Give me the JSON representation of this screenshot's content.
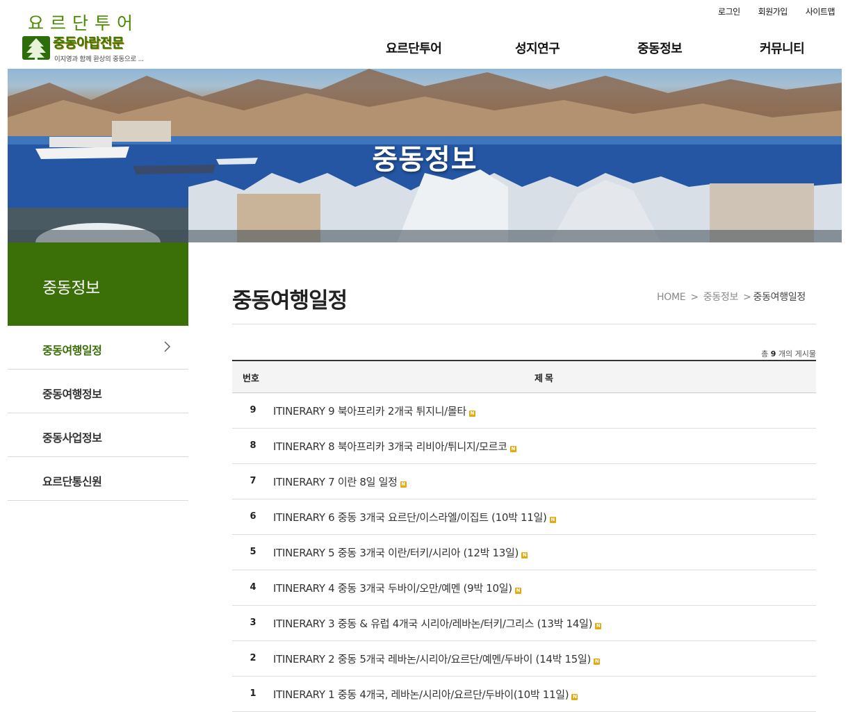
{
  "logo": {
    "top_text": "요르단투어",
    "brand": "중동아랍전문",
    "tagline": "이지영과 함께 환상의 중동으로 ..."
  },
  "util_links": [
    "로그인",
    "회원가입",
    "사이트맵"
  ],
  "gnb": [
    "요르단투어",
    "성지연구",
    "중동정보",
    "커뮤니티"
  ],
  "banner": {
    "title": "중동정보"
  },
  "lnb": {
    "title": "중동정보",
    "items": [
      "중동여행일정",
      "중동여행정보",
      "중동사업정보",
      "요르단통신원"
    ],
    "active_index": 0
  },
  "page": {
    "title": "중동여행일정",
    "breadcrumb": [
      "HOME",
      "중동정보",
      "중동여행일정"
    ],
    "breadcrumb_sep": ">"
  },
  "board": {
    "total_prefix": "총",
    "total_count": "9",
    "total_suffix": "개의 게시물",
    "header_num": "번호",
    "header_title": "제목",
    "new_badge": "N",
    "rows": [
      {
        "num": "9",
        "title": "ITINERARY 9 북아프리카 2개국 튀지니/몰타"
      },
      {
        "num": "8",
        "title": "ITINERARY 8 북아프리카 3개국 리비아/튀니지/모르코"
      },
      {
        "num": "7",
        "title": "ITINERARY 7 이란 8일 일정"
      },
      {
        "num": "6",
        "title": "ITINERARY 6 중동 3개국 요르단/이스라엘/이집트 (10박 11일)"
      },
      {
        "num": "5",
        "title": "ITINERARY 5 중동 3개국 이란/터키/시리아 (12박 13일)"
      },
      {
        "num": "4",
        "title": "ITINERARY 4 중동 3개국 두바이/오만/예멘 (9박 10일)"
      },
      {
        "num": "3",
        "title": "ITINERARY 3 중동 & 유럽 4개국 시리아/레바논/터키/그리스 (13박 14일)"
      },
      {
        "num": "2",
        "title": "ITINERARY 2 중동 5개국 레바논/시리아/요르단/예멘/두바이 (14박 15일)"
      },
      {
        "num": "1",
        "title": "ITINERARY 1 중동 4개국, 레바논/시리아/요르단/두바이(10박 11일)"
      }
    ]
  },
  "colors": {
    "accent_green": "#3b7009",
    "new_badge": "#e2a911",
    "table_header_bg": "#f4f4f4"
  }
}
